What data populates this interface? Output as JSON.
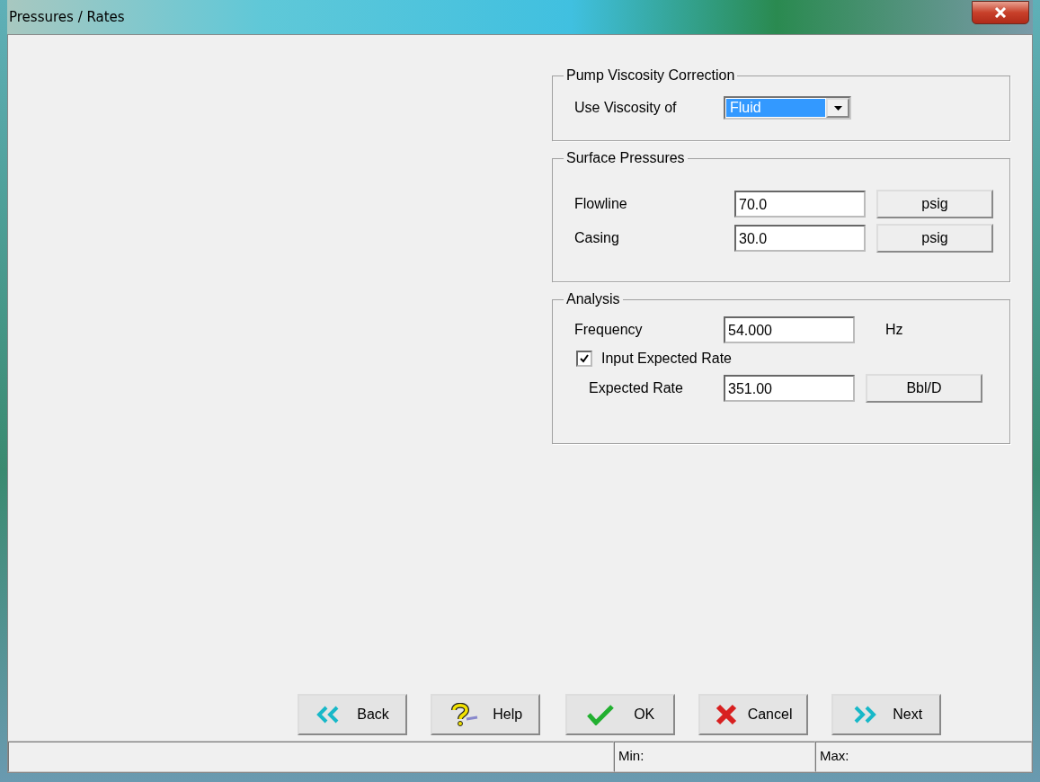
{
  "window": {
    "title": "Pressures / Rates"
  },
  "viscosity": {
    "title": "Pump Viscosity Correction",
    "label": "Use Viscosity of",
    "value": "Fluid"
  },
  "surface_pressures": {
    "title": "Surface Pressures",
    "rows": [
      {
        "label": "Flowline",
        "value": "70.0",
        "unit": "psig"
      },
      {
        "label": "Casing",
        "value": "30.0",
        "unit": "psig"
      }
    ]
  },
  "analysis": {
    "title": "Analysis",
    "frequency": {
      "label": "Frequency",
      "value": "54.000",
      "unit": "Hz"
    },
    "input_expected_rate": {
      "label": "Input Expected Rate",
      "checked": true
    },
    "expected_rate": {
      "label": "Expected Rate",
      "value": "351.00",
      "unit": "Bbl/D"
    }
  },
  "buttons": [
    {
      "label": "Back",
      "kind": "back"
    },
    {
      "label": "Help",
      "kind": "help"
    },
    {
      "label": "OK",
      "kind": "ok"
    },
    {
      "label": "Cancel",
      "kind": "cancel"
    },
    {
      "label": "Next",
      "kind": "next"
    }
  ],
  "status_bar": {
    "min": "Min:",
    "max": "Max:"
  }
}
